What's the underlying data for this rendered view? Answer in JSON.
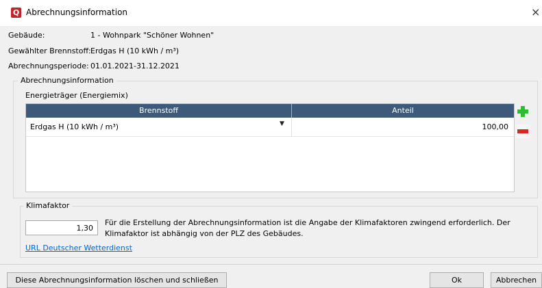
{
  "window": {
    "title": "Abrechnungsinformation",
    "icon_letter": "Q",
    "close_glyph": "×"
  },
  "info": {
    "building_label": "Gebäude:",
    "building_value": "1 - Wohnpark \"Schöner Wohnen\"",
    "fuel_label": "Gewählter Brennstoff:",
    "fuel_value": "Erdgas H (10 kWh / m³)",
    "period_label": "Abrechnungsperiode:",
    "period_value": "01.01.2021-31.12.2021"
  },
  "billing_group": {
    "title": "Abrechnungsinformation",
    "energy_title": "Energieträger (Energiemix)",
    "columns": [
      "Brennstoff",
      "Anteil"
    ],
    "rows": [
      {
        "fuel": "Erdgas H (10 kWh / m³)",
        "share": "100,00"
      }
    ]
  },
  "klima_group": {
    "title": "Klimafaktor",
    "value": "1,30",
    "note": "Für die Erstellung der Abrechnungsinformation ist die Angabe der Klimafaktoren zwingend erforderlich. Der Klimafaktor ist abhängig von der PLZ des Gebäudes.",
    "link": "URL Deutscher Wetterdienst"
  },
  "buttons": {
    "delete_close": "Diese Abrechnungsinformation löschen und schließen",
    "ok": "Ok",
    "cancel": "Abbrechen"
  },
  "colors": {
    "grid_header": "#3d5a7a",
    "add": "#2ebd2e",
    "remove": "#d92626",
    "link": "#0066cc",
    "brand": "#c0242b"
  }
}
